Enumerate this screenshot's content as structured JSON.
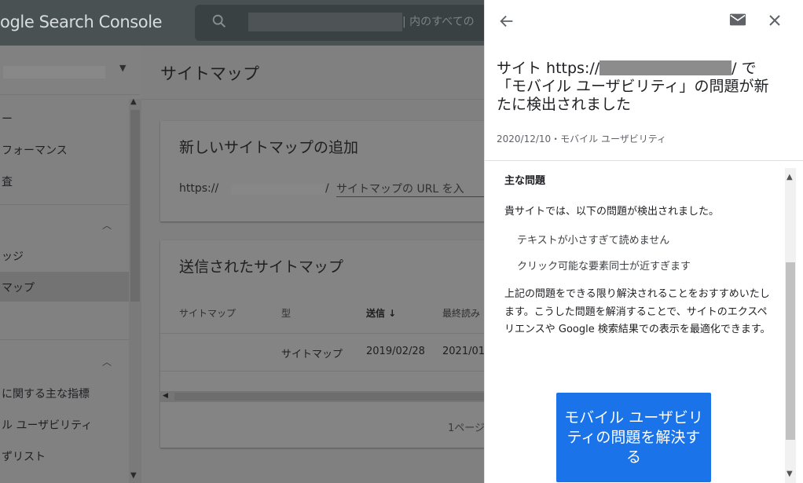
{
  "header": {
    "logo": "ogle Search Console",
    "search_placeholder_visible": "| 内のすべての"
  },
  "sidebar": {
    "items": [
      {
        "label": "ー"
      },
      {
        "label": "フォーマンス"
      },
      {
        "label": "査"
      },
      {
        "label": "ッジ"
      },
      {
        "label": "マップ"
      },
      {
        "label": "に関する主な指標"
      },
      {
        "label": "ル ユーザビリティ"
      },
      {
        "label": "ずリスト"
      }
    ]
  },
  "main": {
    "title": "サイトマップ",
    "add_card": {
      "title": "新しいサイトマップの追加",
      "url_prefix": "https://",
      "slash": "/",
      "input_placeholder": "サイトマップの URL を入"
    },
    "submitted_card": {
      "title": "送信されたサイトマップ",
      "columns": [
        "サイトマップ",
        "型",
        "送信 ↓",
        "最終読み"
      ],
      "rows": [
        {
          "type": "サイトマップ",
          "submitted": "2019/02/28",
          "last_read": "2021/01"
        }
      ],
      "pager": "1ページ"
    }
  },
  "panel": {
    "title_prefix": "サイト https://",
    "title_after": "/ で",
    "title_rest": "「モバイル ユーザビリティ」の問題が新たに検出されました",
    "meta": "2020/12/10・モバイル ユーザビリティ",
    "issues_heading": "主な問題",
    "issues_intro": "貴サイトでは、以下の問題が検出されました。",
    "issues": [
      "テキストが小さすぎて読めません",
      "クリック可能な要素同士が近すぎます"
    ],
    "body": "上記の問題をできる限り解決されることをおすすめいたします。こうした問題を解消することで、サイトのエクスペリエンスや Google 検索結果での表示を最適化できます。",
    "fix_button": "モバイル ユーザビリティの問題を解決する"
  },
  "colors": {
    "accent": "#1a73e8",
    "header_bg": "#4a5152",
    "overlay_gray": "#808080"
  },
  "icons": [
    "search-icon",
    "back-arrow-icon",
    "mail-icon",
    "close-icon",
    "chevron-up-icon",
    "chevron-down-icon",
    "arrow-down-icon"
  ]
}
